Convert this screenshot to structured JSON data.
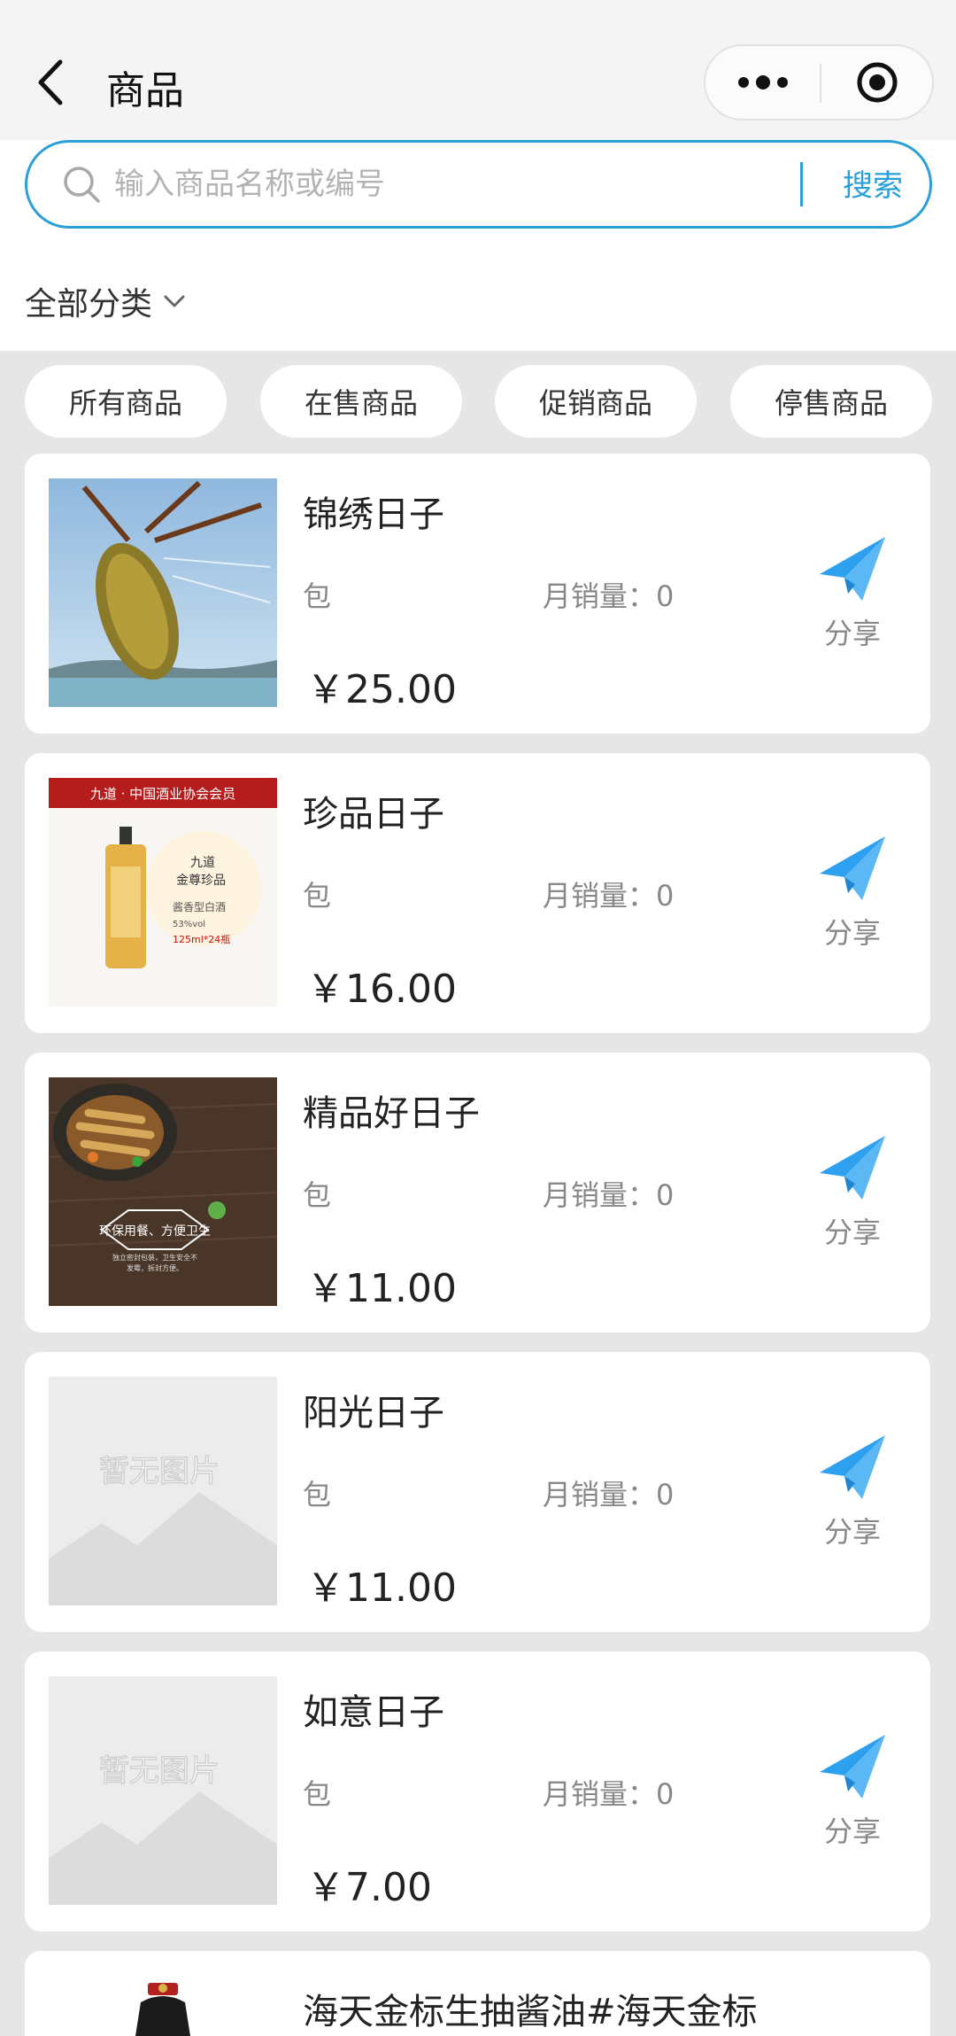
{
  "header": {
    "title": "商品",
    "back_icon": "chevron-left-icon",
    "more_icon": "more-dots-icon",
    "target_icon": "target-icon"
  },
  "search": {
    "placeholder": "输入商品名称或编号",
    "value": "",
    "button_label": "搜索",
    "accent": "#2a9fd8"
  },
  "category": {
    "label": "全部分类"
  },
  "tabs": [
    "所有商品",
    "在售商品",
    "促销商品",
    "停售商品"
  ],
  "products": [
    {
      "name": "锦绣日子",
      "unit": "包",
      "sales": "月销量：0",
      "price": "￥25.00",
      "image": "lobster-photo",
      "share": "分享"
    },
    {
      "name": "珍品日子",
      "unit": "包",
      "sales": "月销量：0",
      "price": "￥16.00",
      "image": "liquor-bottle-photo",
      "share": "分享",
      "image_text": {
        "banner": "九道 · 中国酒业协会会员",
        "line1": "九道",
        "line2": "金尊珍品",
        "line3": "酱香型白酒",
        "line4": "53%vol",
        "line5": "125ml*24瓶"
      }
    },
    {
      "name": "精品好日子",
      "unit": "包",
      "sales": "月销量：0",
      "price": "￥11.00",
      "image": "skewer-food-photo",
      "share": "分享",
      "image_text": {
        "tag": "环保用餐、方便卫生",
        "sub1": "独立密封包装，卫生安全不",
        "sub2": "发霉，拆封方便。"
      }
    },
    {
      "name": "阳光日子",
      "unit": "包",
      "sales": "月销量：0",
      "price": "￥11.00",
      "image": "no-image-placeholder",
      "share": "分享",
      "image_text": {
        "placeholder": "暂无图片"
      }
    },
    {
      "name": "如意日子",
      "unit": "包",
      "sales": "月销量：0",
      "price": "￥7.00",
      "image": "no-image-placeholder",
      "share": "分享",
      "image_text": {
        "placeholder": "暂无图片"
      }
    },
    {
      "name": "海天金标生抽酱油#海天金标",
      "image": "soy-sauce-bottle-photo"
    }
  ]
}
